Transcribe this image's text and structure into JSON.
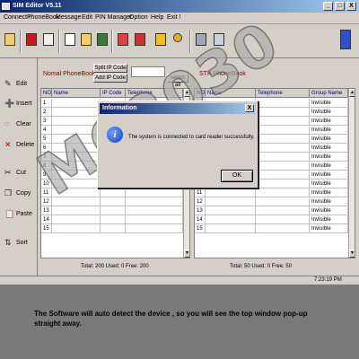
{
  "window": {
    "title": "SIM Editor V5.11",
    "controls": {
      "minimize": "_",
      "maximize": "□",
      "close": "X"
    }
  },
  "menu": [
    "Connect !",
    "PhoneBook",
    "Message",
    "Edit",
    "PIN Manager",
    "Option",
    "Help",
    "Exit !"
  ],
  "toolbar": {
    "icons": [
      "connect-icon",
      "phonebook-red-icon",
      "phonebook-icon",
      "new-file-icon",
      "open-folder-icon",
      "save-icon",
      "import-icon",
      "export-icon",
      "sim-card-icon",
      "key-icon",
      "copy-sim-icon",
      "settings-list-icon",
      "sim-reader-icon"
    ]
  },
  "side_actions": [
    {
      "label": "Edit",
      "icon": "edit-icon"
    },
    {
      "label": "Insert",
      "icon": "insert-icon"
    },
    {
      "label": "Clear",
      "icon": "clear-icon"
    },
    {
      "label": "Delete",
      "icon": "delete-icon"
    },
    {
      "label": "Cut",
      "icon": "cut-icon"
    },
    {
      "label": "Copy",
      "icon": "copy-icon"
    },
    {
      "label": "Paste",
      "icon": "paste-icon"
    },
    {
      "label": "Sort",
      "icon": "sort-icon"
    }
  ],
  "normal_phonebook": {
    "title": "Nomal PhoneBook",
    "split_label": "Split IP Code",
    "add_label": "Add IP Code",
    "select_all_label": "select all",
    "ip_input_value": "",
    "columns": [
      "NO.",
      "Name",
      "IP Code",
      "Telephone"
    ],
    "rows": [
      "1",
      "2",
      "3",
      "4",
      "5",
      "6",
      "7",
      "8",
      "9",
      "10",
      "11",
      "12",
      "13",
      "14",
      "15"
    ],
    "footer": "Total: 200  Used: 0  Free: 200"
  },
  "stk_phonebook": {
    "title": "STK PhoneBook",
    "columns": [
      "NO.",
      "Name",
      "Telephone",
      "Group Name"
    ],
    "rows": [
      "1",
      "2",
      "3",
      "4",
      "5",
      "6",
      "7",
      "8",
      "9",
      "10",
      "11",
      "12",
      "13",
      "14",
      "15"
    ],
    "group_value": "Invisible",
    "footer": "Total: 50  Used: 0  Free: 50"
  },
  "status": {
    "time": "7:23:19 PM"
  },
  "dialog": {
    "title": "Information",
    "message": "The system is connected to card reader successfully.",
    "ok_label": "OK",
    "close_label": "X"
  },
  "watermark": "MC2030",
  "caption": "The Software will auto detect the device , so you will see the top window pop-up straight away.",
  "colors": {
    "titlebar_start": "#0a246a",
    "titlebar_end": "#a6caf0",
    "face": "#d4d0c8",
    "header_text": "#000080",
    "panel_title": "#800000",
    "caption_bg": "#7a7a7a"
  }
}
